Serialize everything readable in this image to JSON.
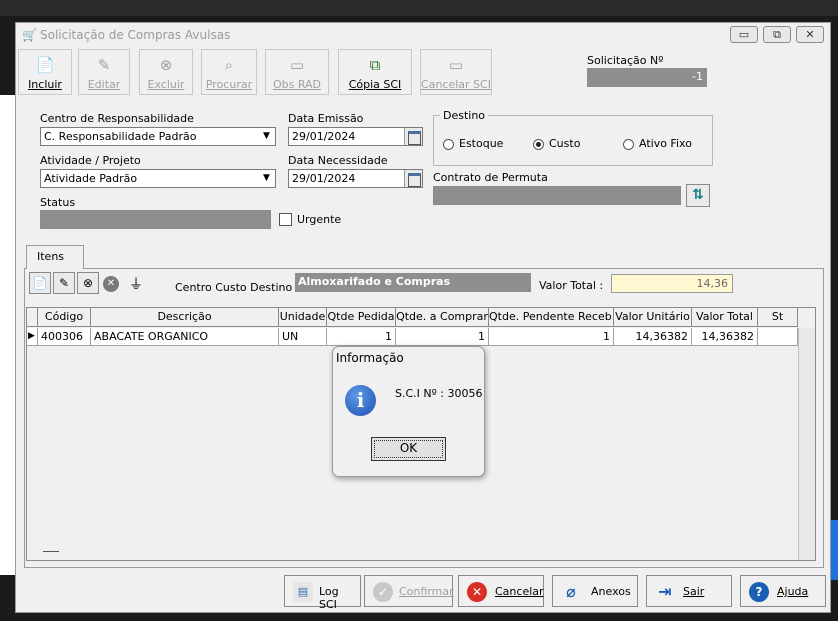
{
  "window": {
    "title": "Solicitação de Compras Avulsas",
    "controls": [
      "minimize",
      "restore",
      "close"
    ]
  },
  "toolbar": {
    "buttons": [
      {
        "label": "Incluir",
        "enabled": true,
        "icon": "new-doc-icon"
      },
      {
        "label": "Editar",
        "enabled": false,
        "icon": "edit-doc-icon"
      },
      {
        "label": "Excluir",
        "enabled": false,
        "icon": "delete-doc-icon"
      },
      {
        "label": "Procurar",
        "enabled": false,
        "icon": "search-doc-icon"
      },
      {
        "label": "Obs RAD",
        "enabled": false,
        "icon": "monitor-icon"
      },
      {
        "label": "Cópia SCI",
        "enabled": true,
        "icon": "copy-icon"
      },
      {
        "label": "Cancelar SCI",
        "enabled": false,
        "icon": "cancel-monitor-icon"
      }
    ]
  },
  "solicitacao": {
    "label": "Solicitação Nº",
    "value": "-1"
  },
  "form": {
    "centro_label": "Centro de Responsabilidade",
    "centro_value": "C. Responsabilidade Padrão",
    "data_emissao_label": "Data Emissão",
    "data_emissao_value": "29/01/2024",
    "atividade_label": "Atividade / Projeto",
    "atividade_value": "Atividade Padrão",
    "data_necessidade_label": "Data Necessidade",
    "data_necessidade_value": "29/01/2024",
    "status_label": "Status",
    "status_value": "",
    "urgente_label": "Urgente",
    "urgente_checked": false,
    "destino_label": "Destino",
    "destino_options": [
      "Estoque",
      "Custo",
      "Ativo Fixo"
    ],
    "destino_selected": "Custo",
    "contrato_label": "Contrato de Permuta",
    "contrato_value": ""
  },
  "tabs": [
    {
      "label": "Itens",
      "active": true
    }
  ],
  "items_toolbar": {
    "centro_custo_label": "Centro Custo Destino",
    "centro_custo_value": "Almoxarifado e Compras",
    "valor_total_label": "Valor Total :",
    "valor_total_value": "14,36"
  },
  "grid": {
    "columns": [
      "Código",
      "Descrição",
      "Unidade",
      "Qtde Pedida",
      "Qtde. a Comprar",
      "Qtde. Pendente Receb.",
      "Valor Unitário",
      "Valor Total",
      "St"
    ],
    "rows": [
      [
        "400306",
        "ABACATE ORGANICO",
        "UN",
        "1",
        "1",
        "1",
        "14,36382",
        "14,36382",
        ""
      ]
    ]
  },
  "bottom_buttons": [
    {
      "label": "Log SCI",
      "enabled": true
    },
    {
      "label": "Confirmar",
      "enabled": false
    },
    {
      "label": "Cancelar",
      "enabled": true
    },
    {
      "label": "Anexos",
      "enabled": true
    },
    {
      "label": "Sair",
      "enabled": true
    },
    {
      "label": "Ajuda",
      "enabled": true
    }
  ],
  "dialog": {
    "title": "Informação",
    "message": "S.C.I Nº : 30056",
    "ok_label": "OK",
    "icon": "info-icon"
  },
  "colors": {
    "info_blue": "#1d4fb0",
    "cancel_red": "#d93025",
    "help_blue": "#1a5fb4",
    "valor_total_bg": "#fff8d0"
  }
}
